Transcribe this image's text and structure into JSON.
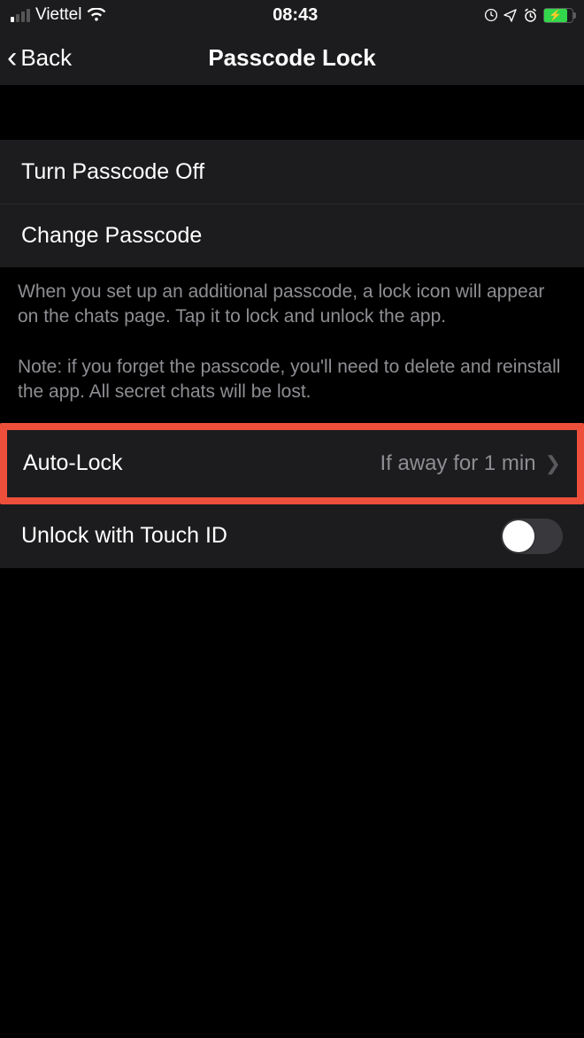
{
  "statusbar": {
    "carrier": "Viettel",
    "time": "08:43"
  },
  "nav": {
    "back": "Back",
    "title": "Passcode Lock"
  },
  "group1": {
    "turn_off": "Turn Passcode Off",
    "change": "Change Passcode"
  },
  "footer": {
    "line1": "When you set up an additional passcode, a lock icon will appear on the chats page. Tap it to lock and unlock the app.",
    "line2": "Note: if you forget the passcode, you'll need to delete and reinstall the app. All secret chats will be lost."
  },
  "group2": {
    "autolock_label": "Auto-Lock",
    "autolock_value": "If away for 1 min",
    "touchid_label": "Unlock with Touch ID",
    "touchid_on": false
  },
  "highlight": {
    "color": "#ee4f3b",
    "target": "auto-lock-row"
  }
}
